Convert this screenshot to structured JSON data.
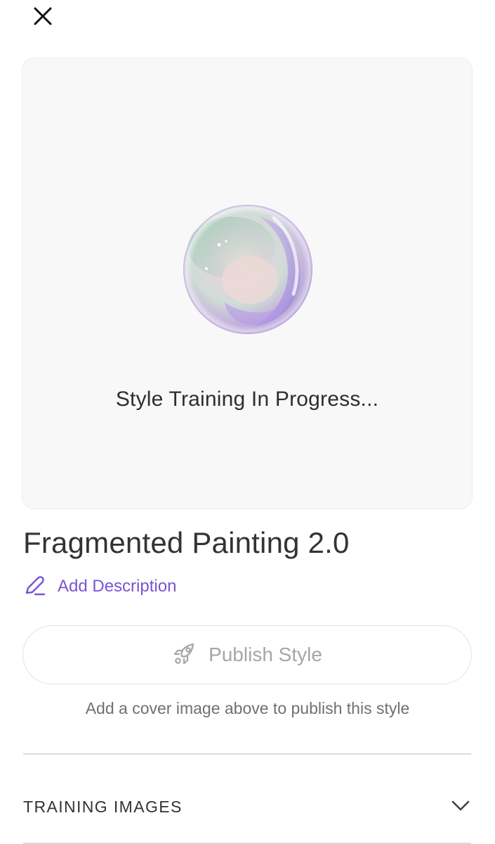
{
  "icons": {
    "close": "close-icon",
    "add_description": "pencil-icon",
    "publish": "rocket-icon",
    "section_toggle": "chevron-down-icon"
  },
  "preview": {
    "status_text": "Style Training In Progress..."
  },
  "style": {
    "title": "Fragmented Painting 2.0",
    "add_description_label": "Add Description"
  },
  "publish": {
    "button_label": "Publish Style",
    "hint": "Add a cover image above to publish this style"
  },
  "sections": {
    "training_images": {
      "title": "TRAINING IMAGES"
    }
  },
  "colors": {
    "accent": "#7b53d6",
    "disabled_text": "#a6a6a6",
    "card_bg": "#f8f8f8"
  }
}
